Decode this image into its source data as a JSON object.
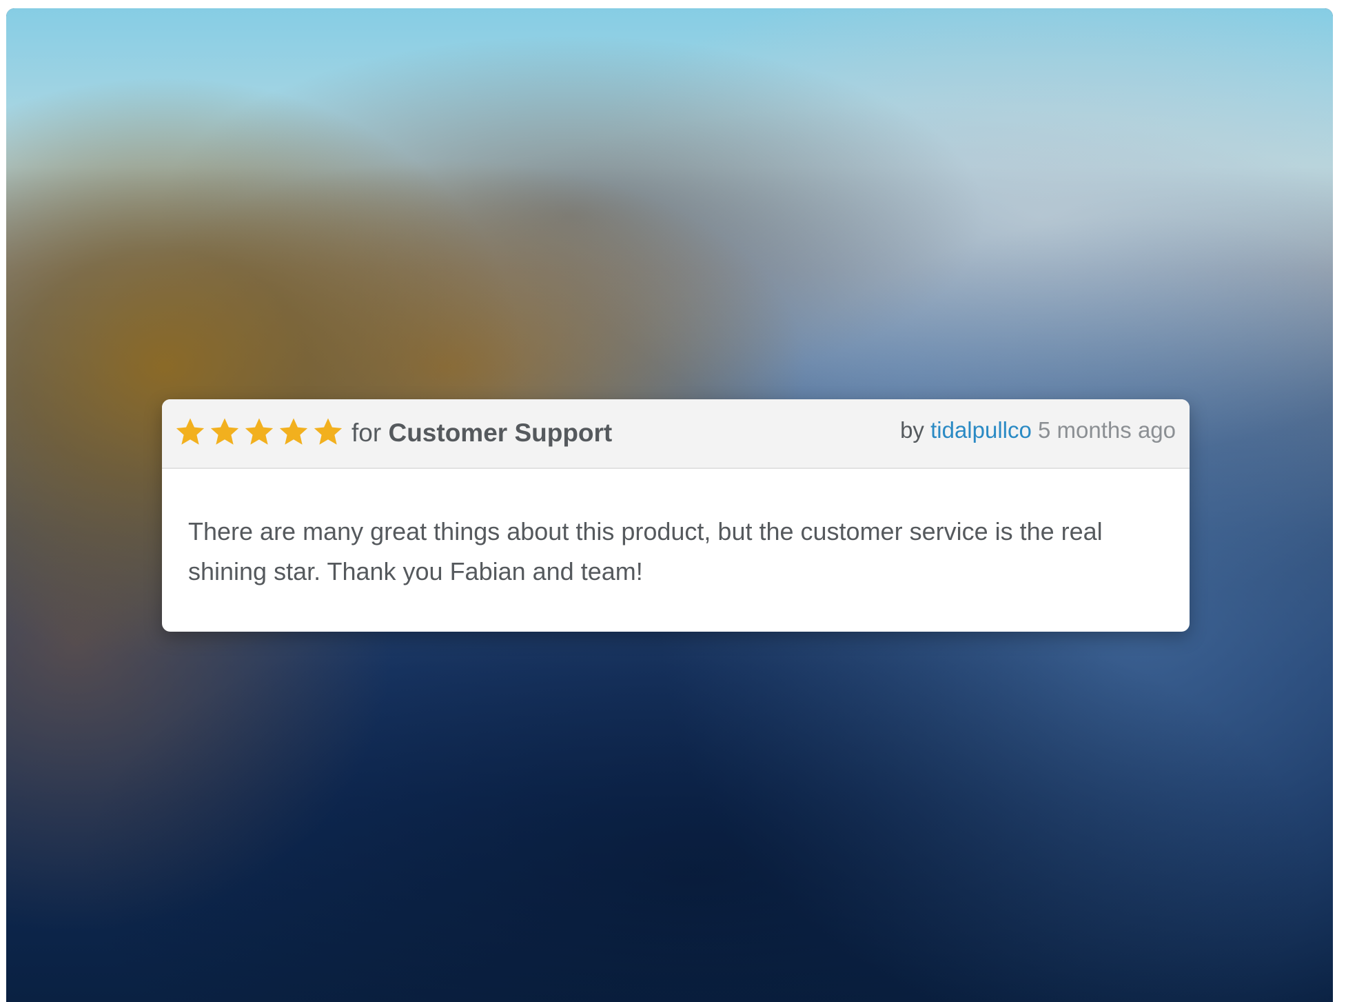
{
  "review": {
    "rating": 5,
    "rating_max": 5,
    "star_color": "#f2b01e",
    "for_label": "for",
    "category": "Customer Support",
    "by_label": "by",
    "author": "tidalpullco",
    "time_ago": "5 months ago",
    "text": "There are many great things about this product, but the customer service is the real shining star. Thank you Fabian and team!"
  },
  "colors": {
    "author_link": "#2a8ac4",
    "header_bg": "#f3f3f3",
    "text": "#55595d"
  }
}
